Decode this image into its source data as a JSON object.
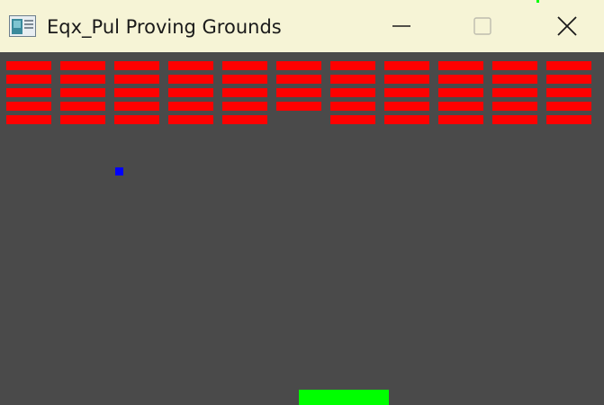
{
  "window": {
    "title": "Eqx_Pul Proving Grounds",
    "icon": "app-window-icon",
    "buttons": [
      "minimize-icon",
      "maximize-icon",
      "close-icon"
    ]
  },
  "game": {
    "background_color": "#4a4a4a",
    "brick_color": "#ff0000",
    "ball_color": "#0000ff",
    "paddle_color": "#00ff00",
    "columns": 11,
    "rows": 5,
    "bricks_present": [
      [
        1,
        1,
        1,
        1,
        1,
        1,
        1,
        1,
        1,
        1,
        1
      ],
      [
        1,
        1,
        1,
        1,
        1,
        1,
        1,
        1,
        1,
        1,
        1
      ],
      [
        1,
        1,
        1,
        1,
        1,
        1,
        1,
        1,
        1,
        1,
        1
      ],
      [
        1,
        1,
        1,
        1,
        1,
        1,
        1,
        1,
        1,
        1,
        1
      ],
      [
        1,
        1,
        1,
        1,
        1,
        0,
        1,
        1,
        1,
        1,
        1
      ]
    ]
  }
}
